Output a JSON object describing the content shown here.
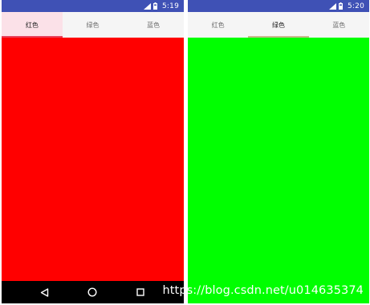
{
  "colors": {
    "status_bar": "#3f51b5",
    "tab_bar_bg": "#f5f5f5",
    "active_tab_tint": "#fbe1e8",
    "red_indicator": "#e8425a",
    "green_indicator": "#c8b88c",
    "red_page": "#ff0000",
    "green_page": "#00ff00",
    "nav_bar": "#000000"
  },
  "screens": [
    {
      "status_bar": {
        "time": "5:19",
        "icons": [
          "signal-icon",
          "battery-icon"
        ]
      },
      "tabs": [
        {
          "label": "红色",
          "active": true
        },
        {
          "label": "绿色",
          "active": false
        },
        {
          "label": "蓝色",
          "active": false
        }
      ],
      "content_color": "red",
      "nav_bar": {
        "buttons": [
          "back-icon",
          "home-icon",
          "recents-icon"
        ]
      }
    },
    {
      "status_bar": {
        "time": "5:20",
        "icons": [
          "signal-icon",
          "battery-icon"
        ]
      },
      "tabs": [
        {
          "label": "红色",
          "active": false
        },
        {
          "label": "绿色",
          "active": true
        },
        {
          "label": "蓝色",
          "active": false
        }
      ],
      "content_color": "green"
    }
  ],
  "watermark": "https://blog.csdn.net/u014635374"
}
